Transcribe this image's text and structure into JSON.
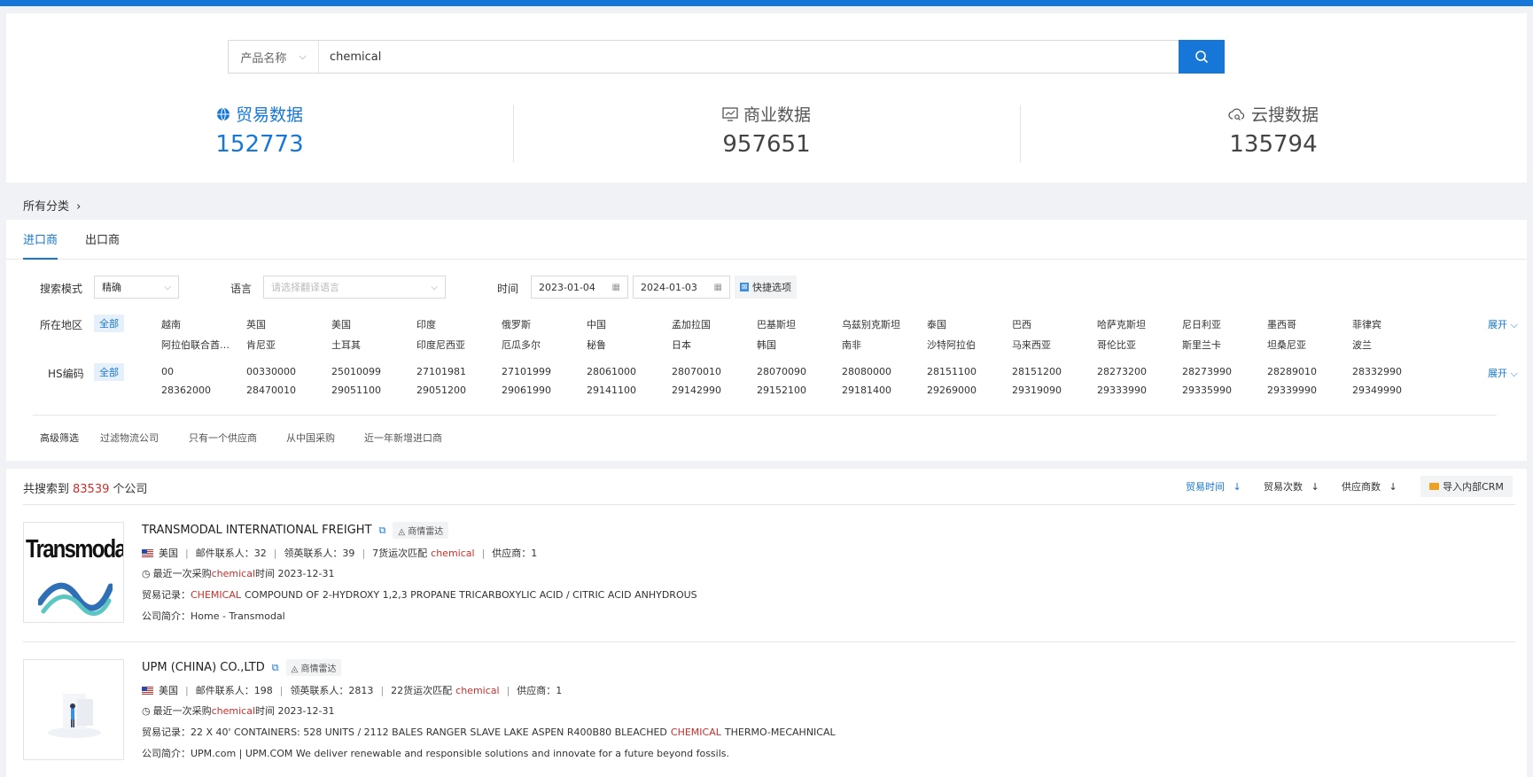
{
  "search": {
    "type_label": "产品名称",
    "query": "chemical"
  },
  "stats": [
    {
      "label": "贸易数据",
      "value": "152773",
      "icon": "globe-icon"
    },
    {
      "label": "商业数据",
      "value": "957651",
      "icon": "monitor-chart-icon"
    },
    {
      "label": "云搜数据",
      "value": "135794",
      "icon": "cloud-search-icon"
    }
  ],
  "category_crumb": "所有分类",
  "tabs": [
    "进口商",
    "出口商"
  ],
  "filters": {
    "mode_label": "搜索模式",
    "mode_value": "精确",
    "lang_label": "语言",
    "lang_placeholder": "请选择翻译语言",
    "time_label": "时间",
    "date_from": "2023-01-04",
    "date_to": "2024-01-03",
    "quick_label": "快捷选项",
    "region_label": "所在地区",
    "all_label": "全部",
    "regions_row1": [
      "越南",
      "英国",
      "美国",
      "印度",
      "俄罗斯",
      "中国",
      "孟加拉国",
      "巴基斯坦",
      "乌兹别克斯坦",
      "泰国",
      "巴西",
      "哈萨克斯坦",
      "尼日利亚",
      "墨西哥",
      "菲律宾"
    ],
    "regions_row2": [
      "阿拉伯联合酋长国",
      "肯尼亚",
      "土耳其",
      "印度尼西亚",
      "厄瓜多尔",
      "秘鲁",
      "日本",
      "韩国",
      "南非",
      "沙特阿拉伯",
      "马来西亚",
      "哥伦比亚",
      "斯里兰卡",
      "坦桑尼亚",
      "波兰"
    ],
    "hs_label": "HS编码",
    "hs_row1": [
      "00",
      "00330000",
      "25010099",
      "27101981",
      "27101999",
      "28061000",
      "28070010",
      "28070090",
      "28080000",
      "28151100",
      "28151200",
      "28273200",
      "28273990",
      "28289010",
      "28332990"
    ],
    "hs_row2": [
      "28362000",
      "28470010",
      "29051100",
      "29051200",
      "29061990",
      "29141100",
      "29142990",
      "29152100",
      "29181400",
      "29269000",
      "29319090",
      "29333990",
      "29335990",
      "29339990",
      "29349990"
    ],
    "expand_label": "展开",
    "advanced_label": "高级筛选",
    "advanced_options": [
      "过滤物流公司",
      "只有一个供应商",
      "从中国采购",
      "近一年新增进口商"
    ]
  },
  "results": {
    "prefix": "共搜索到",
    "count": "83539",
    "suffix": "个公司",
    "sorts": [
      "贸易时间",
      "贸易次数",
      "供应商数"
    ],
    "crm_label": "导入内部CRM",
    "companies": [
      {
        "name": "TRANSMODAL INTERNATIONAL FREIGHT",
        "radar": "商情雷达",
        "country": "美国",
        "email_contacts": "邮件联系人：32",
        "linkedin_contacts": "领英联系人：39",
        "shipment_prefix": "7货运次匹配",
        "keyword": "chemical",
        "suppliers": "供应商：1",
        "last_purchase_prefix": "最近一次采购",
        "last_purchase_suffix": "时间 2023-12-31",
        "trade_prefix": "贸易记录：",
        "trade_hl": "CHEMICAL",
        "trade_rest": "COMPOUND OF 2-HYDROXY 1,2,3 PROPANE TRICARBOXYLIC ACID / CITRIC ACID ANHYDROUS",
        "trade_tail": "",
        "intro": "公司简介：Home - Transmodal",
        "logo_text": "Transmodal"
      },
      {
        "name": "UPM (CHINA) CO.,LTD",
        "radar": "商情雷达",
        "country": "美国",
        "email_contacts": "邮件联系人：198",
        "linkedin_contacts": "领英联系人：2813",
        "shipment_prefix": "22货运次匹配",
        "keyword": "chemical",
        "suppliers": "供应商：1",
        "last_purchase_prefix": "最近一次采购",
        "last_purchase_suffix": "时间 2023-12-31",
        "trade_prefix": "贸易记录：",
        "trade_hl": "CHEMICAL",
        "trade_rest": "22 X 40' CONTAINERS: 528 UNITS / 2112 BALES RANGER SLAVE LAKE ASPEN R400B80 BLEACHED",
        "trade_tail": "THERMO-MECAHNICAL",
        "intro": "公司简介：UPM.com | UPM.COM We deliver renewable and responsible solutions and innovate for a future beyond fossils."
      }
    ]
  },
  "colors": {
    "accent": "#1677d9",
    "highlight": "#c9302c"
  }
}
